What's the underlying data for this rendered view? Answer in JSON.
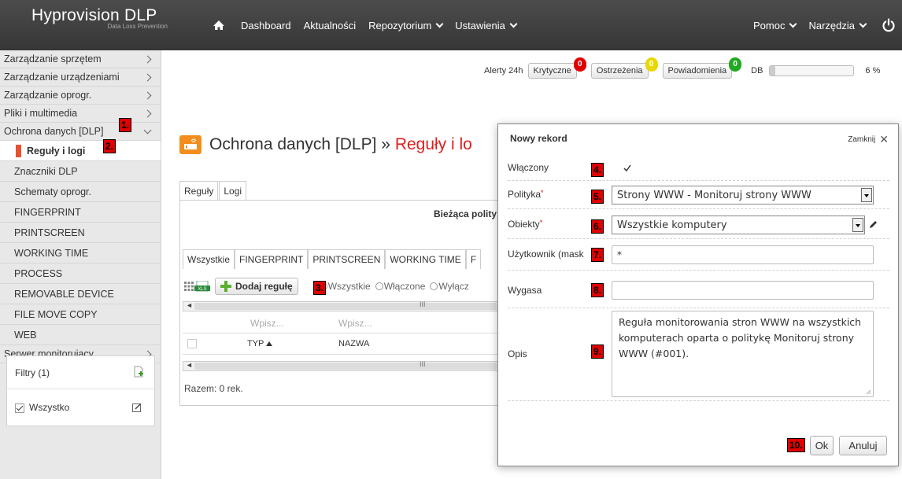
{
  "brand": {
    "name": "Hyprovision",
    "name_suffix": "DLP",
    "tagline": "Data Loss Prevention"
  },
  "topnav": {
    "home_icon": "home-icon",
    "items": [
      "Dashboard",
      "Aktualności",
      "Repozytorium",
      "Ustawienia"
    ],
    "right_items": [
      "Pomoc",
      "Narzędzia"
    ],
    "power_icon": "power-icon"
  },
  "sidebar": {
    "items": [
      "Zarządzanie sprzętem",
      "Zarządzanie urządzeniami",
      "Zarządzanie oprogr.",
      "Pliki i multimedia",
      "Ochrona danych [DLP]"
    ],
    "subitems": [
      "Reguły i logi",
      "Znaczniki DLP",
      "Schematy oprogr.",
      "FINGERPRINT",
      "PRINTSCREEN",
      "WORKING TIME",
      "PROCESS",
      "REMOVABLE DEVICE",
      "FILE MOVE COPY",
      "WEB"
    ],
    "last_item": "Serwer monitorujący",
    "filters_title": "Filtry (1)",
    "filter_item": "Wszystko"
  },
  "alerts": {
    "label": "Alerty 24h",
    "critical": "Krytyczne",
    "critical_count": "0",
    "warnings": "Ostrzeżenia",
    "warnings_count": "0",
    "notifications": "Powiadomienia",
    "notifications_count": "0",
    "db_label": "DB",
    "db_percent": "6 %",
    "db_fill_fraction": 0.06,
    "colors": {
      "critical": "#e00000",
      "warnings": "#e8d800",
      "notifications": "#22a822"
    }
  },
  "page": {
    "title": "Ochrona danych [DLP] »",
    "title_accent": "Reguły i lo",
    "tabs": [
      "Reguły",
      "Logi"
    ],
    "current_policy": "Bieżąca polity",
    "inner_tabs": [
      "Wszystkie",
      "FINGERPRINT",
      "PRINTSCREEN",
      "WORKING TIME",
      "F"
    ],
    "add_rule": "Dodaj regułę",
    "radios": [
      "Wszystkie",
      "Włączone",
      "Wyłącz"
    ],
    "filter_placeholders": [
      "Wpisz...",
      "Wpisz..."
    ],
    "columns": [
      "TYP",
      "NAZWA"
    ],
    "scroll_mark": "III",
    "total": "Razem: 0 rek."
  },
  "modal": {
    "title": "Nowy rekord",
    "close": "Zamknij",
    "fields": {
      "enabled_label": "Włączony",
      "policy_label": "Polityka",
      "policy_value": "Strony WWW - Monitoruj strony WWW",
      "objects_label": "Obiekty",
      "objects_value": "Wszystkie komputery",
      "user_label": "Użytkownik (mask",
      "user_value": "*",
      "expires_label": "Wygasa",
      "expires_value": "",
      "desc_label": "Opis",
      "desc_value": "Reguła monitorowania stron WWW na wszystkich komputerach oparta o politykę Monitoruj strony WWW (#001)."
    },
    "ok": "Ok",
    "cancel": "Anuluj"
  },
  "markers": [
    "1.",
    "2.",
    "3.",
    "4.",
    "5.",
    "6.",
    "7.",
    "8.",
    "9.",
    "10."
  ]
}
